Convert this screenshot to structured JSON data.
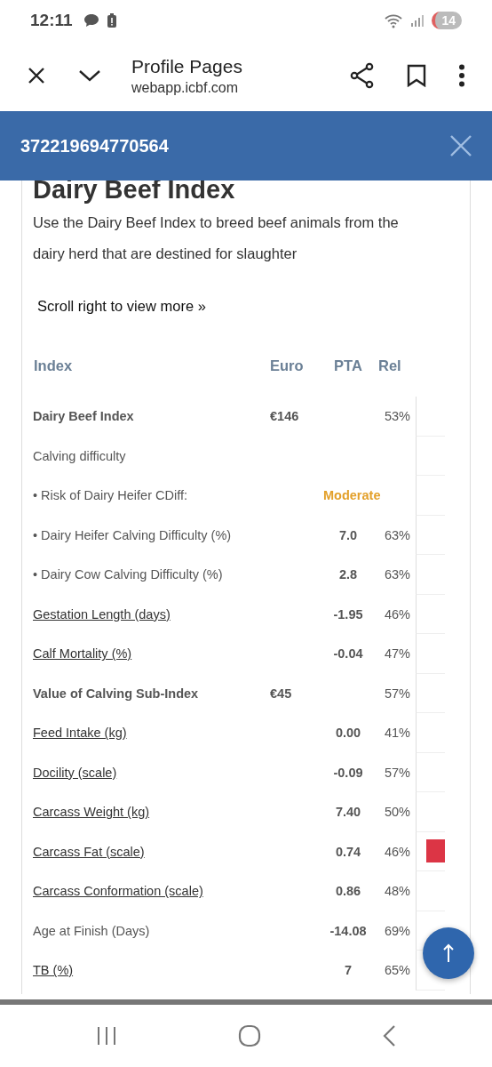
{
  "status_bar": {
    "time": "12:11",
    "battery": "14"
  },
  "browser": {
    "title": "Profile Pages",
    "url": "webapp.icbf.com"
  },
  "dialog": {
    "title": "372219694770564"
  },
  "section": {
    "heading": "Dairy Beef Index",
    "description": "Use the Dairy Beef Index to breed beef animals from the dairy herd that are destined for slaughter",
    "scroll_hint": "Scroll right to view more »"
  },
  "table": {
    "columns": [
      "Index",
      "Euro",
      "PTA",
      "Rel"
    ],
    "rows": [
      {
        "kind": "bold",
        "label": "Dairy Beef Index",
        "euro": "€146",
        "rel": "53%",
        "flagged": false
      },
      {
        "kind": "plain",
        "label": "Calving difficulty",
        "flagged": false
      },
      {
        "kind": "risk",
        "label": "• Risk of Dairy Heifer CDiff:",
        "pta": "Moderate",
        "flagged": false
      },
      {
        "kind": "plain",
        "label": "• Dairy Heifer Calving Difficulty (%)",
        "pta": "7.0",
        "rel": "63%",
        "flagged": false
      },
      {
        "kind": "plain",
        "label": "• Dairy Cow Calving Difficulty (%)",
        "pta": "2.8",
        "rel": "63%",
        "flagged": false
      },
      {
        "kind": "link",
        "label": "Gestation Length (days)",
        "pta": "-1.95",
        "rel": "46%",
        "flagged": false
      },
      {
        "kind": "link",
        "label": "Calf Mortality (%)",
        "pta": "-0.04",
        "rel": "47%",
        "flagged": false
      },
      {
        "kind": "bold",
        "label": "Value of Calving Sub-Index",
        "euro": "€45",
        "rel": "57%",
        "flagged": false
      },
      {
        "kind": "link",
        "label": "Feed Intake (kg)",
        "pta": "0.00",
        "rel": "41%",
        "flagged": false
      },
      {
        "kind": "link",
        "label": "Docility (scale)",
        "pta": "-0.09",
        "rel": "57%",
        "flagged": false
      },
      {
        "kind": "link",
        "label": "Carcass Weight (kg)",
        "pta": "7.40",
        "rel": "50%",
        "flagged": false
      },
      {
        "kind": "link",
        "label": "Carcass Fat (scale)",
        "pta": "0.74",
        "rel": "46%",
        "flagged": true
      },
      {
        "kind": "link",
        "label": "Carcass Conformation (scale)",
        "pta": "0.86",
        "rel": "48%",
        "flagged": false
      },
      {
        "kind": "plain",
        "label": "Age at Finish (Days)",
        "pta": "-14.08",
        "rel": "69%",
        "flagged": false
      },
      {
        "kind": "link",
        "label": "TB (%)",
        "pta": "7",
        "rel": "65%",
        "flagged": false
      }
    ]
  }
}
